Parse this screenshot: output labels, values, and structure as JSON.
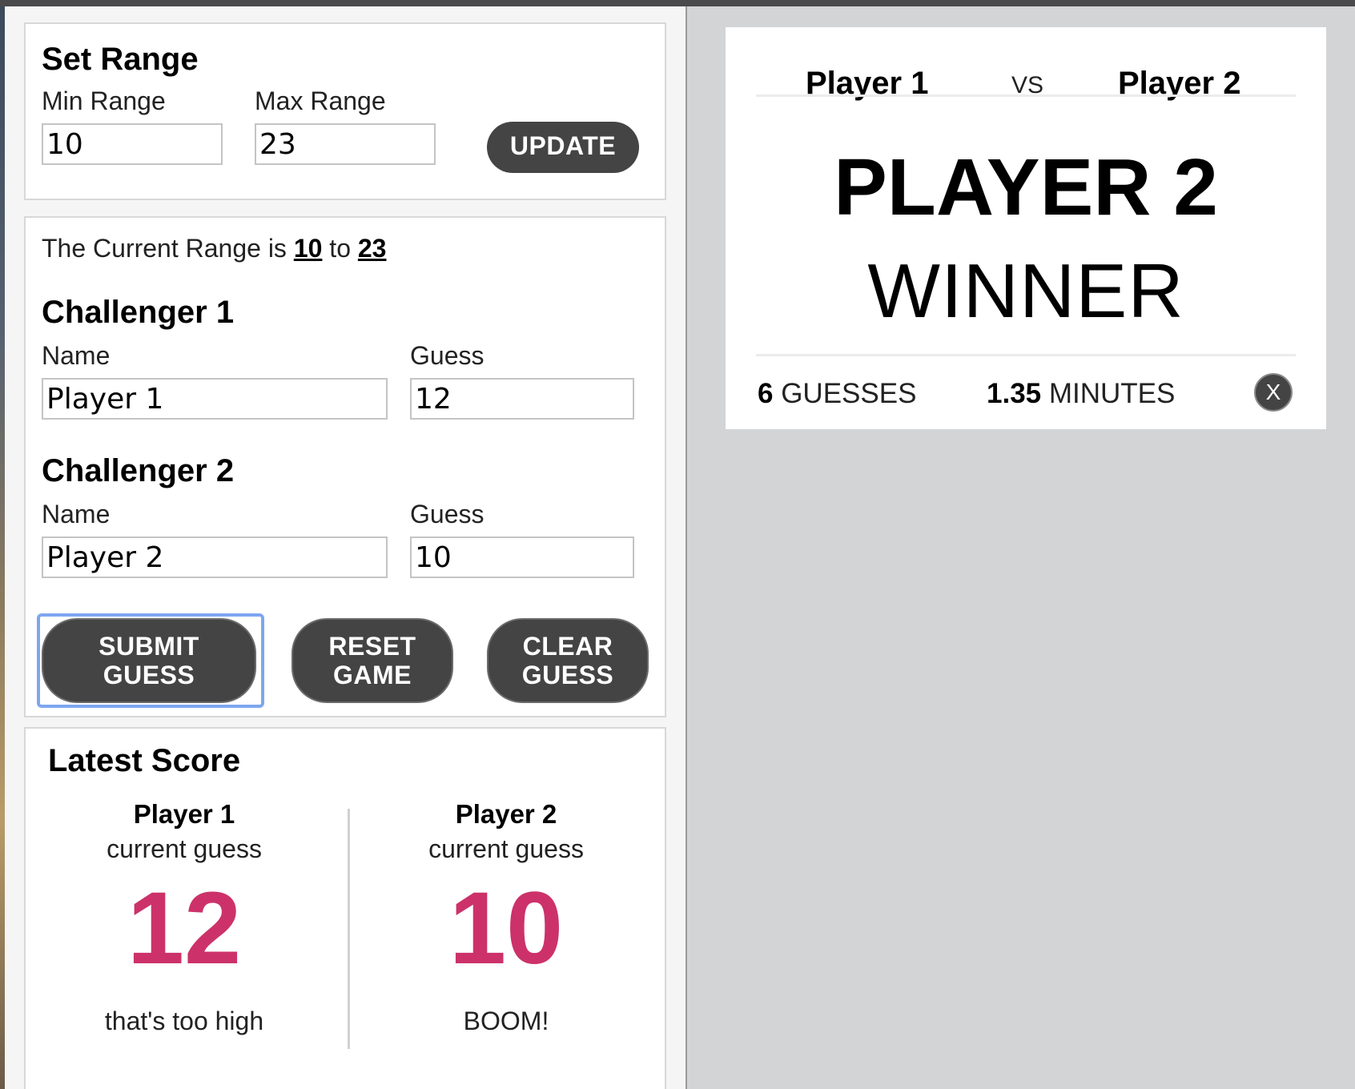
{
  "set_range": {
    "title": "Set Range",
    "min_label": "Min Range",
    "min_value": "10",
    "max_label": "Max Range",
    "max_value": "23",
    "update_label": "UPDATE"
  },
  "current_range": {
    "prefix": "The Current Range is",
    "min": "10",
    "middle": "to",
    "max": "23"
  },
  "challenger1": {
    "title": "Challenger 1",
    "name_label": "Name",
    "name_value": "Player 1",
    "guess_label": "Guess",
    "guess_value": "12"
  },
  "challenger2": {
    "title": "Challenger 2",
    "name_label": "Name",
    "name_value": "Player 2",
    "guess_label": "Guess",
    "guess_value": "10"
  },
  "buttons": {
    "submit_line1": "SUBMIT",
    "submit_line2": "GUESS",
    "reset_line1": "RESET",
    "reset_line2": "GAME",
    "clear_line1": "CLEAR",
    "clear_line2": "GUESS"
  },
  "latest_score": {
    "title": "Latest Score",
    "players": [
      {
        "name": "Player 1",
        "sub": "current guess",
        "guess": "12",
        "message": "that's too high"
      },
      {
        "name": "Player 2",
        "sub": "current guess",
        "guess": "10",
        "message": "BOOM!"
      }
    ]
  },
  "result": {
    "player1": "Player 1",
    "vs": "VS",
    "player2": "Player 2",
    "winner_name": "PLAYER 2",
    "winner_label": "WINNER",
    "guesses_count": "6",
    "guesses_label": "GUESSES",
    "minutes_value": "1.35",
    "minutes_label": "MINUTES",
    "close_label": "X"
  },
  "colors": {
    "accent": "#cc3269",
    "button": "#444444",
    "focus": "#7ea6f0",
    "background": "#d3d4d6"
  }
}
